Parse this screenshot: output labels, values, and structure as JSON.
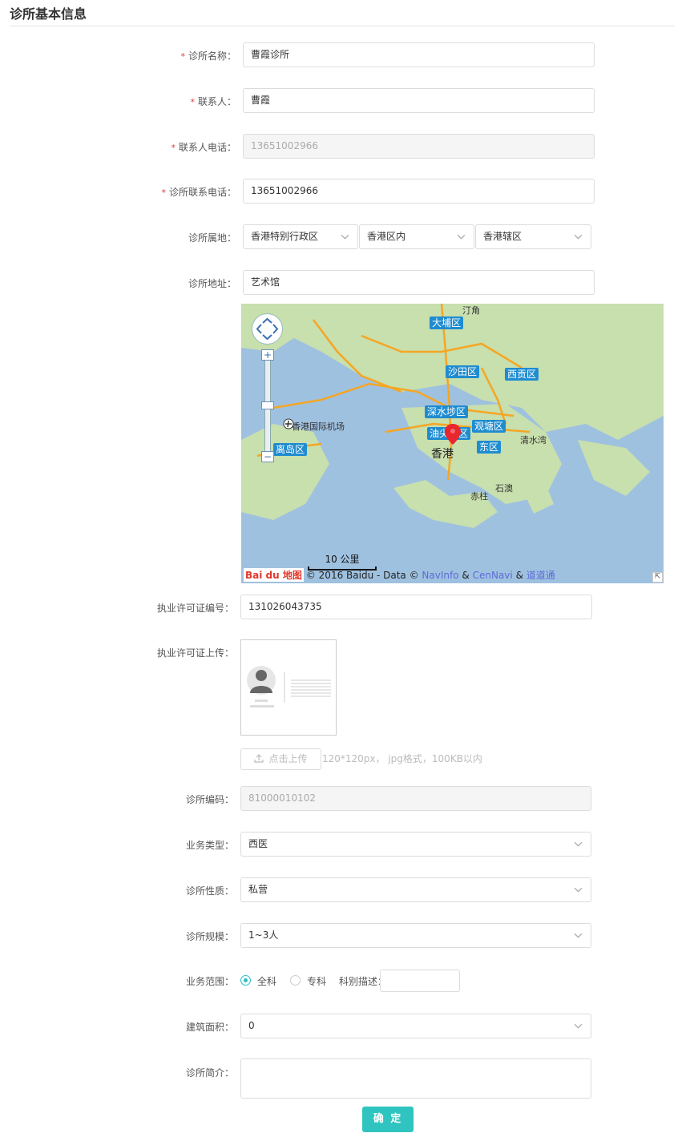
{
  "section_title": "诊所基本信息",
  "required_mark": "*",
  "form": {
    "clinic_name": {
      "label": "诊所名称：",
      "value": "曹霞诊所"
    },
    "contact": {
      "label": "联系人：",
      "value": "曹霞"
    },
    "contact_phone": {
      "label": "联系人电话：",
      "value": "13651002966"
    },
    "clinic_phone": {
      "label": "诊所联系电话：",
      "value": "13651002966"
    },
    "region": {
      "label": "诊所属地：",
      "province": "香港特别行政区",
      "city": "香港区内",
      "district": "香港辖区"
    },
    "address": {
      "label": "诊所地址：",
      "value": "艺术馆"
    },
    "license_no": {
      "label": "执业许可证编号：",
      "value": "131026043735"
    },
    "license_upload": {
      "label": "执业许可证上传：",
      "button": "点击上传",
      "hint": "120*120px， jpg格式，100KB以内"
    },
    "clinic_code": {
      "label": "诊所编码：",
      "value": "81000010102"
    },
    "business_type": {
      "label": "业务类型：",
      "value": "西医"
    },
    "clinic_nature": {
      "label": "诊所性质：",
      "value": "私营"
    },
    "clinic_scale": {
      "label": "诊所规模：",
      "value": "1~3人"
    },
    "business_scope": {
      "label": "业务范围：",
      "options": [
        "全科",
        "专科"
      ],
      "selected": "全科",
      "dept_label": "科别描述："
    },
    "building_area": {
      "label": "建筑面积：",
      "value": "0"
    },
    "intro": {
      "label": "诊所简介："
    }
  },
  "map": {
    "districts": [
      "大埔区",
      "沙田区",
      "西贡区",
      "深水埗区",
      "观塘区",
      "油尖旺区",
      "东区",
      "离岛区"
    ],
    "places": [
      "汀角",
      "香港国际机场",
      "清水湾",
      "石澳",
      "赤柱",
      "香港"
    ],
    "scale": "10 公里",
    "logo": "Bai du 地图",
    "copyright": "© 2016 Baidu - Data © ",
    "providers": [
      "NavInfo",
      "CenNavi",
      "道道通"
    ],
    "amp": "&",
    "zoom_in": "+",
    "zoom_out": "−"
  },
  "submit_label": "确 定",
  "colors": {
    "accent": "#2fc4bf",
    "required": "#e4393c",
    "map_water": "#9fc1e0",
    "map_land": "#c8dfae",
    "map_road": "#f5a623",
    "district_tag": "#1f8cd0"
  }
}
